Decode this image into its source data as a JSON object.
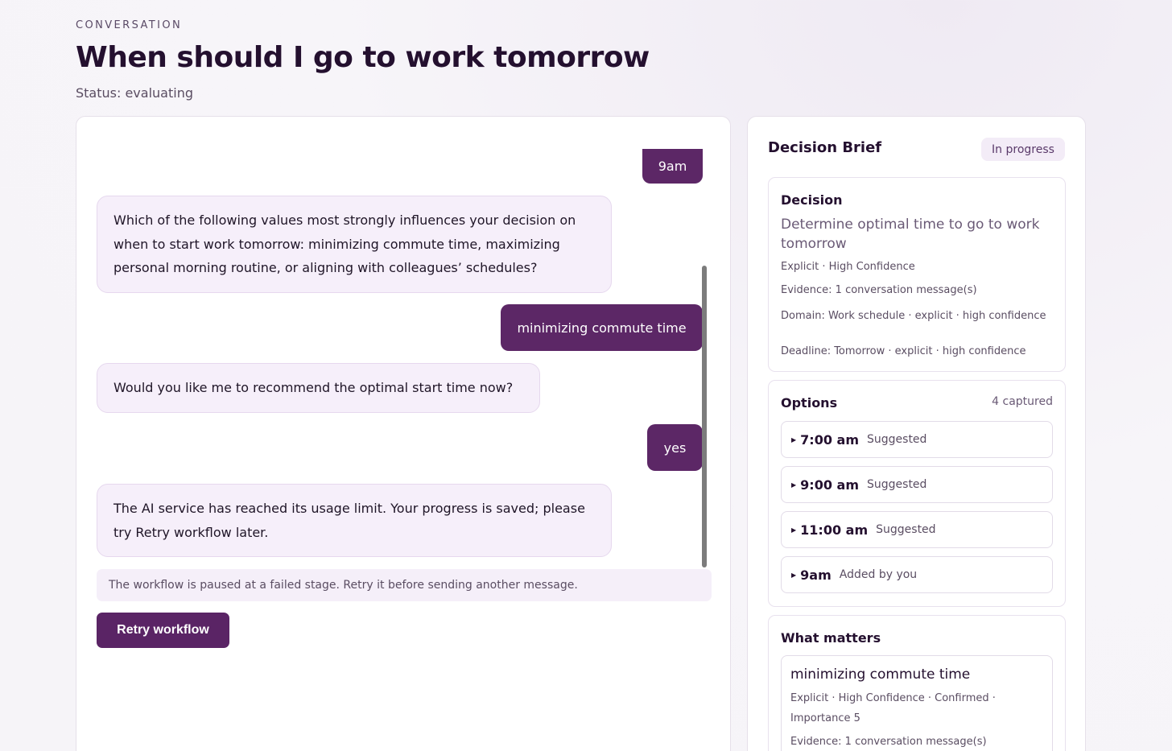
{
  "header": {
    "eyebrow": "CONVERSATION",
    "title": "When should I go to work tomorrow",
    "status": "Status: evaluating"
  },
  "chat": {
    "messages": [
      {
        "role": "user",
        "text": "9am"
      },
      {
        "role": "assistant",
        "text": "Which of the following values most strongly influences your decision on when to start work tomorrow: minimizing commute time, maximizing personal morning routine, or aligning with colleagues’ schedules?"
      },
      {
        "role": "user",
        "text": "minimizing commute time"
      },
      {
        "role": "assistant",
        "text": "Would you like me to recommend the optimal start time now?"
      },
      {
        "role": "user",
        "text": "yes"
      },
      {
        "role": "assistant",
        "text": "The AI service has reached its usage limit. Your progress is saved; please try Retry workflow later."
      }
    ],
    "notice": "The workflow is paused at a failed stage. Retry it before sending another message.",
    "retry_label": "Retry workflow"
  },
  "brief": {
    "title": "Decision Brief",
    "badge": "In progress",
    "decision": {
      "heading": "Decision",
      "text": "Determine optimal time to go to work tomorrow",
      "meta": "Explicit · High Confidence",
      "evidence": "Evidence: 1 conversation message(s)",
      "domain": "Domain: Work schedule · explicit · high confidence",
      "deadline": "Deadline: Tomorrow · explicit · high confidence"
    },
    "options": {
      "heading": "Options",
      "count": "4 captured",
      "items": [
        {
          "time": "7:00 am",
          "tag": "Suggested"
        },
        {
          "time": "9:00 am",
          "tag": "Suggested"
        },
        {
          "time": "11:00 am",
          "tag": "Suggested"
        },
        {
          "time": "9am",
          "tag": "Added by you"
        }
      ]
    },
    "matters": {
      "heading": "What matters",
      "item_title": "minimizing commute time",
      "item_meta": "Explicit · High Confidence · Confirmed · Importance 5",
      "item_evidence": "Evidence: 1 conversation message(s)"
    }
  },
  "colors": {
    "accent": "#5c2766",
    "bubble_ai_bg": "#f6effa"
  }
}
